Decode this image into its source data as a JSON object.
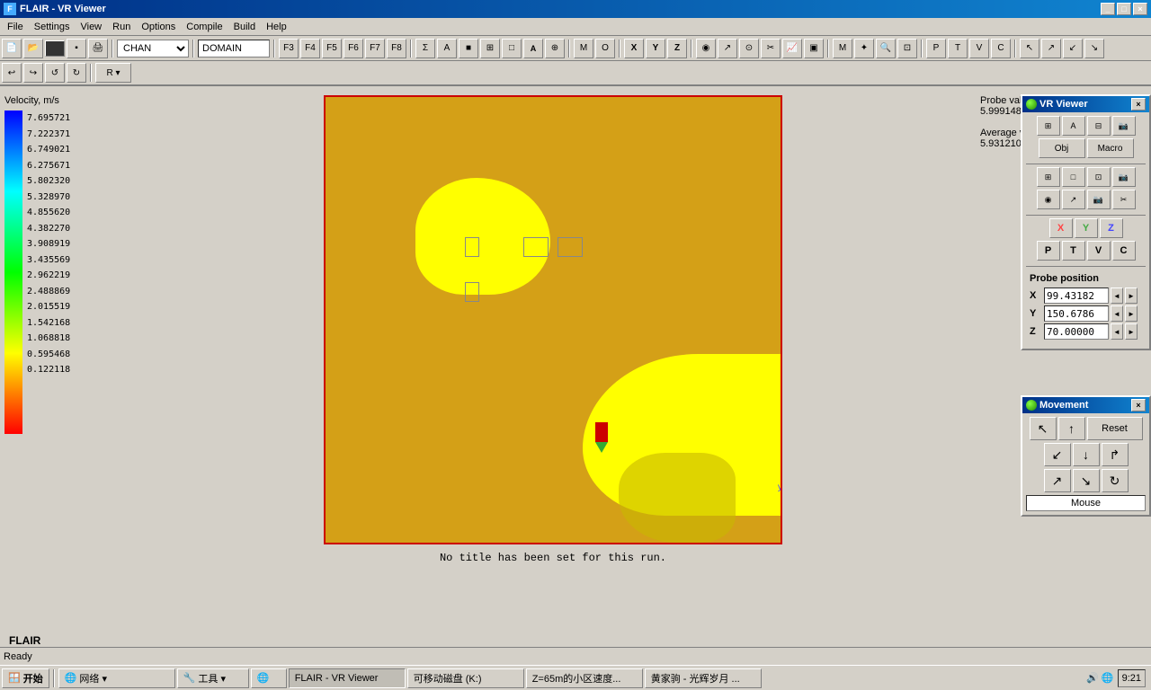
{
  "window": {
    "title": "FLAIR - VR Viewer",
    "icon": "F"
  },
  "menu": {
    "items": [
      "File",
      "Settings",
      "View",
      "Run",
      "Options",
      "Compile",
      "Build",
      "Help"
    ]
  },
  "toolbar1": {
    "chan_label": "CHAN",
    "domain_label": "DOMAIN",
    "buttons": [
      "F3",
      "F4",
      "F5",
      "F6",
      "F7",
      "F8",
      "Σ",
      "A",
      "⬛",
      "⊞",
      "□",
      "A",
      "⊕",
      "M",
      "O",
      "X",
      "Y",
      "Z",
      "◉",
      "↗",
      "⊙",
      "✂",
      "📈",
      "▣",
      "M",
      "✦",
      "🔍",
      "⊡",
      "P",
      "T",
      "V",
      "C",
      "↖",
      "↗",
      "↙",
      "↘"
    ]
  },
  "toolbar2": {
    "buttons": [
      "↩",
      "↪",
      "↺",
      "↻",
      "R ▾"
    ]
  },
  "legend": {
    "title": "Velocity, m/s",
    "values": [
      "7.695721",
      "7.222371",
      "6.749021",
      "6.275671",
      "5.802320",
      "5.328970",
      "4.855620",
      "4.382270",
      "3.908919",
      "3.435569",
      "2.962219",
      "2.488869",
      "2.015519",
      "1.542168",
      "1.068818",
      "0.595468",
      "0.122118"
    ]
  },
  "probe": {
    "label": "Probe value",
    "value": "5.999148",
    "avg_label": "Average value",
    "avg_value": "5.931210"
  },
  "caption": "No title has been set for this run.",
  "flair_label": "FLAIR",
  "status": "Ready",
  "vr_viewer": {
    "title": "VR Viewer",
    "buttons_row1": [
      "⊞",
      "A",
      "⊟",
      "📷"
    ],
    "obj_label": "Obj",
    "macro_label": "Macro",
    "buttons_row2": [
      "⊞",
      "□",
      "⊡",
      "📷"
    ],
    "buttons_row3": [
      "◉",
      "↗",
      "📷",
      "✂"
    ],
    "xyz": [
      "X",
      "Y",
      "Z"
    ],
    "pTVC": [
      "P",
      "T",
      "V",
      "C"
    ]
  },
  "probe_position": {
    "title": "Probe position",
    "x_label": "X",
    "x_value": "99.43182",
    "y_label": "Y",
    "y_value": "150.6786",
    "z_label": "Z",
    "z_value": "70.00000"
  },
  "movement": {
    "title": "Movement",
    "reset_label": "Reset",
    "mouse_label": "Mouse"
  },
  "taskbar": {
    "start_label": "开始",
    "tasks": [
      {
        "label": "网络 ▾",
        "icon": "🌐"
      },
      {
        "label": "工具 ▾",
        "icon": "🔧"
      },
      {
        "label": "●",
        "icon": "●"
      },
      {
        "label": "FLAIR - VR Viewer",
        "active": true
      },
      {
        "label": "可移动磁盘 (K:)"
      },
      {
        "label": "Z=65m的小区速度..."
      },
      {
        "label": "黄家驹 - 光辉岁月 ..."
      }
    ],
    "clock": "9:21"
  }
}
